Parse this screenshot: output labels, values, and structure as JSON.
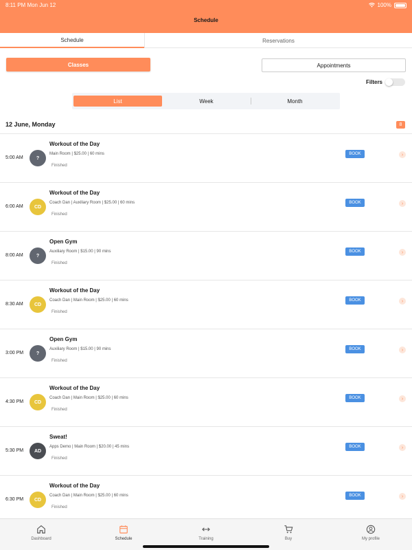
{
  "status_bar": {
    "time": "8:11 PM",
    "date": "Mon Jun 12",
    "battery": "100%"
  },
  "header": {
    "title": "Schedule"
  },
  "top_tabs": [
    {
      "label": "Schedule"
    },
    {
      "label": "Reservations"
    }
  ],
  "buttons": {
    "classes": "Classes",
    "appointments": "Appointments"
  },
  "filters": {
    "label": "Filters"
  },
  "view_tabs": [
    {
      "label": "List"
    },
    {
      "label": "Week"
    },
    {
      "label": "Month"
    }
  ],
  "date_section": {
    "title": "12 June, Monday",
    "count": "8"
  },
  "classes": [
    {
      "time": "5:00 AM",
      "avatar": "?",
      "title": "Workout of the Day",
      "meta": "Main Room | $25.00 | 60 mins",
      "status": "Finished",
      "book": "BOOK"
    },
    {
      "time": "6:00 AM",
      "avatar": "CD",
      "title": "Workout of the Day",
      "meta": "Coach Dan | Auxiliary Room | $25.00 | 60 mins",
      "status": "Finished",
      "book": "BOOK"
    },
    {
      "time": "8:00 AM",
      "avatar": "?",
      "title": "Open Gym",
      "meta": "Auxiliary Room | $15.00 | 90 mins",
      "status": "Finished",
      "book": "BOOK"
    },
    {
      "time": "8:30 AM",
      "avatar": "CD",
      "title": "Workout of the Day",
      "meta": "Coach Dan | Main Room | $25.00 | 60 mins",
      "status": "Finished",
      "book": "BOOK"
    },
    {
      "time": "3:00 PM",
      "avatar": "?",
      "title": "Open Gym",
      "meta": "Auxiliary Room | $15.00 | 90 mins",
      "status": "Finished",
      "book": "BOOK"
    },
    {
      "time": "4:30 PM",
      "avatar": "CD",
      "title": "Workout of the Day",
      "meta": "Coach Dan | Main Room | $25.00 | 60 mins",
      "status": "Finished",
      "book": "BOOK"
    },
    {
      "time": "5:30 PM",
      "avatar": "AD",
      "title": "Sweat!",
      "meta": "Apps Demo | Main Room | $20.00 | 45 mins",
      "status": "Finished",
      "book": "BOOK"
    },
    {
      "time": "6:30 PM",
      "avatar": "CD",
      "title": "Workout of the Day",
      "meta": "Coach Dan | Main Room | $25.00 | 60 mins",
      "status": "Finished",
      "book": "BOOK"
    }
  ],
  "bottom_nav": [
    {
      "label": "Dashboard",
      "icon": "home-icon"
    },
    {
      "label": "Schedule",
      "icon": "calendar-icon"
    },
    {
      "label": "Training",
      "icon": "arrows-icon"
    },
    {
      "label": "Buy",
      "icon": "cart-icon"
    },
    {
      "label": "My profile",
      "icon": "profile-icon"
    }
  ],
  "colors": {
    "accent": "#ff8c5a",
    "book": "#4a90e2",
    "avatar_grey": "#616670",
    "avatar_yellow": "#e8c53c"
  }
}
